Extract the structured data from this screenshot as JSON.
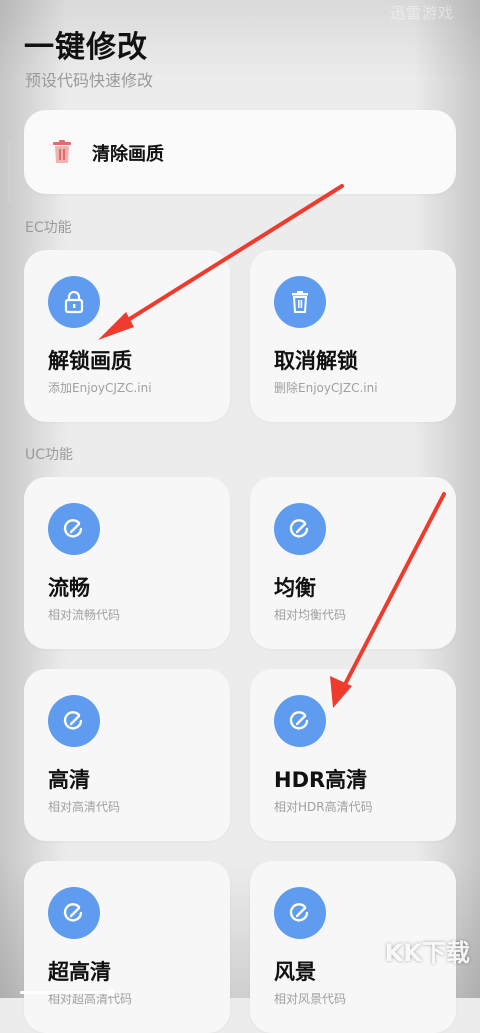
{
  "header": {
    "title": "一键修改",
    "subtitle": "预设代码快速修改",
    "watermark": "迅雷游戏"
  },
  "clear": {
    "label": "清除画质",
    "icon": "trash-icon",
    "icon_color": "#e46a6a"
  },
  "sections": {
    "ec": "EC功能",
    "uc": "UC功能"
  },
  "ec_items": [
    {
      "title": "解锁画质",
      "desc": "添加EnjoyCJZC.ini",
      "icon": "lock-icon"
    },
    {
      "title": "取消解锁",
      "desc": "删除EnjoyCJZC.ini",
      "icon": "trash-icon"
    }
  ],
  "uc_items": [
    {
      "title": "流畅",
      "desc": "相对流畅代码",
      "icon": "edit-icon"
    },
    {
      "title": "均衡",
      "desc": "相对均衡代码",
      "icon": "edit-icon"
    },
    {
      "title": "高清",
      "desc": "相对高清代码",
      "icon": "edit-icon"
    },
    {
      "title": "HDR高清",
      "desc": "相对HDR高清代码",
      "icon": "edit-icon"
    },
    {
      "title": "超高清",
      "desc": "相对超高清代码",
      "icon": "edit-icon"
    },
    {
      "title": "风景",
      "desc": "相对风景代码",
      "icon": "edit-icon"
    }
  ],
  "colors": {
    "accent": "#5f9cf0",
    "arrow": "#ef3b2d",
    "card": "#f7f7f7",
    "background": "#ececec"
  },
  "corner_logo": "KK下载"
}
